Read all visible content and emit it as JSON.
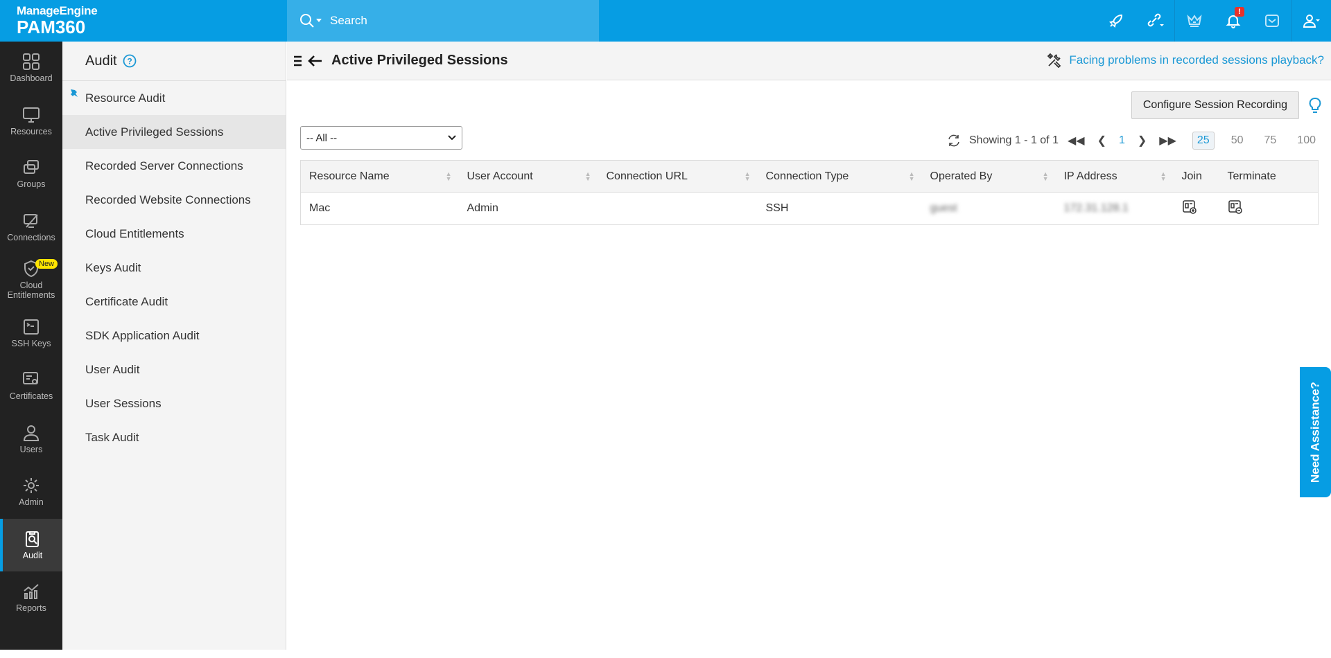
{
  "header": {
    "brand": "ManageEngine",
    "product": "PAM360",
    "search_placeholder": "Search",
    "alert_badge": "!"
  },
  "nav": [
    {
      "label": "Dashboard"
    },
    {
      "label": "Resources"
    },
    {
      "label": "Groups"
    },
    {
      "label": "Connections"
    },
    {
      "label": "Cloud Entitlements",
      "badge": "New"
    },
    {
      "label": "SSH Keys"
    },
    {
      "label": "Certificates"
    },
    {
      "label": "Users"
    },
    {
      "label": "Admin"
    },
    {
      "label": "Audit"
    },
    {
      "label": "Reports"
    }
  ],
  "submenu": {
    "title": "Audit",
    "items": [
      "Resource Audit",
      "Active Privileged Sessions",
      "Recorded Server Connections",
      "Recorded Website Connections",
      "Cloud Entitlements",
      "Keys Audit",
      "Certificate Audit",
      "SDK Application Audit",
      "User Audit",
      "User Sessions",
      "Task Audit"
    ]
  },
  "main": {
    "title": "Active Privileged Sessions",
    "help_link": "Facing problems in recorded sessions playback?",
    "configure_button": "Configure Session Recording",
    "filter_value": "-- All --",
    "pager": {
      "showing": "Showing 1 - 1 of 1",
      "page": "1",
      "sizes": [
        "25",
        "50",
        "75",
        "100"
      ]
    },
    "columns": [
      "Resource Name",
      "User Account",
      "Connection URL",
      "Connection Type",
      "Operated By",
      "IP Address",
      "Join",
      "Terminate"
    ],
    "rows": [
      {
        "resource": "Mac",
        "account": "Admin",
        "url": "",
        "type": "SSH",
        "operated_by": "guest",
        "ip": "172.31.128.1"
      }
    ]
  },
  "assist": "Need Assistance?"
}
